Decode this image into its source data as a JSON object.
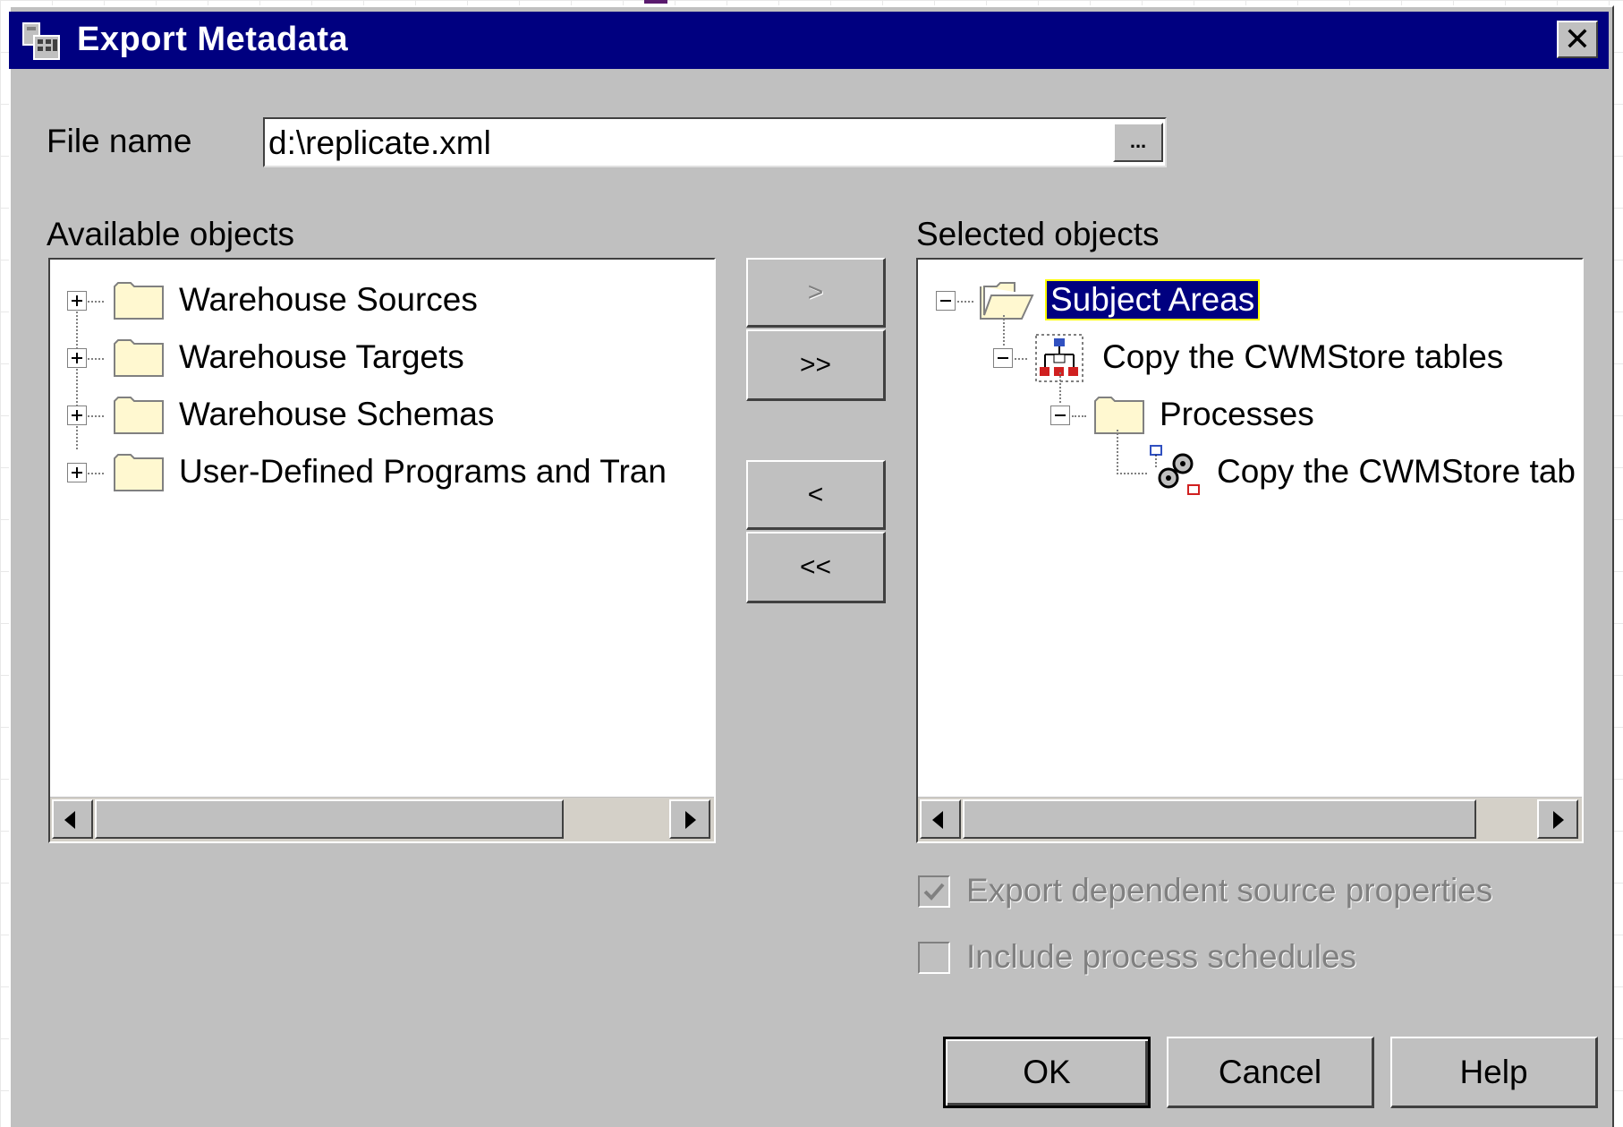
{
  "window": {
    "title": "Export Metadata",
    "close_glyph": "✕",
    "icon": "export-metadata-icon"
  },
  "file": {
    "label": "File name",
    "value": "d:\\replicate.xml",
    "browse_label": "..."
  },
  "available": {
    "label": "Available objects",
    "items": [
      {
        "label": "Warehouse Sources",
        "icon": "folder-icon",
        "expander": "plus"
      },
      {
        "label": "Warehouse Targets",
        "icon": "folder-icon",
        "expander": "plus"
      },
      {
        "label": "Warehouse Schemas",
        "icon": "folder-icon",
        "expander": "plus"
      },
      {
        "label": "User-Defined Programs and Tran",
        "icon": "folder-icon",
        "expander": "plus"
      }
    ]
  },
  "selected": {
    "label": "Selected objects",
    "items": [
      {
        "label": "Subject Areas",
        "icon": "open-folder-icon",
        "expander": "minus",
        "selected": true
      },
      {
        "label": "Copy the CWMStore tables",
        "icon": "subject-area-icon",
        "expander": "minus"
      },
      {
        "label": "Processes",
        "icon": "folder-icon",
        "expander": "minus"
      },
      {
        "label": "Copy the CWMStore tab",
        "icon": "process-icon",
        "expander": "none"
      }
    ]
  },
  "transfer_buttons": {
    "add": ">",
    "add_all": ">>",
    "remove": "<",
    "remove_all": "<<"
  },
  "options": {
    "export_dependent": {
      "label": "Export dependent source properties",
      "checked": true,
      "enabled": false
    },
    "include_schedules": {
      "label": "Include process schedules",
      "checked": false,
      "enabled": false
    }
  },
  "actions": {
    "ok": "OK",
    "cancel": "Cancel",
    "help": "Help"
  },
  "colors": {
    "titlebar": "#000080",
    "dialog": "#c0c0c0",
    "selection": "#000080",
    "selection_outline": "#ffff00"
  }
}
